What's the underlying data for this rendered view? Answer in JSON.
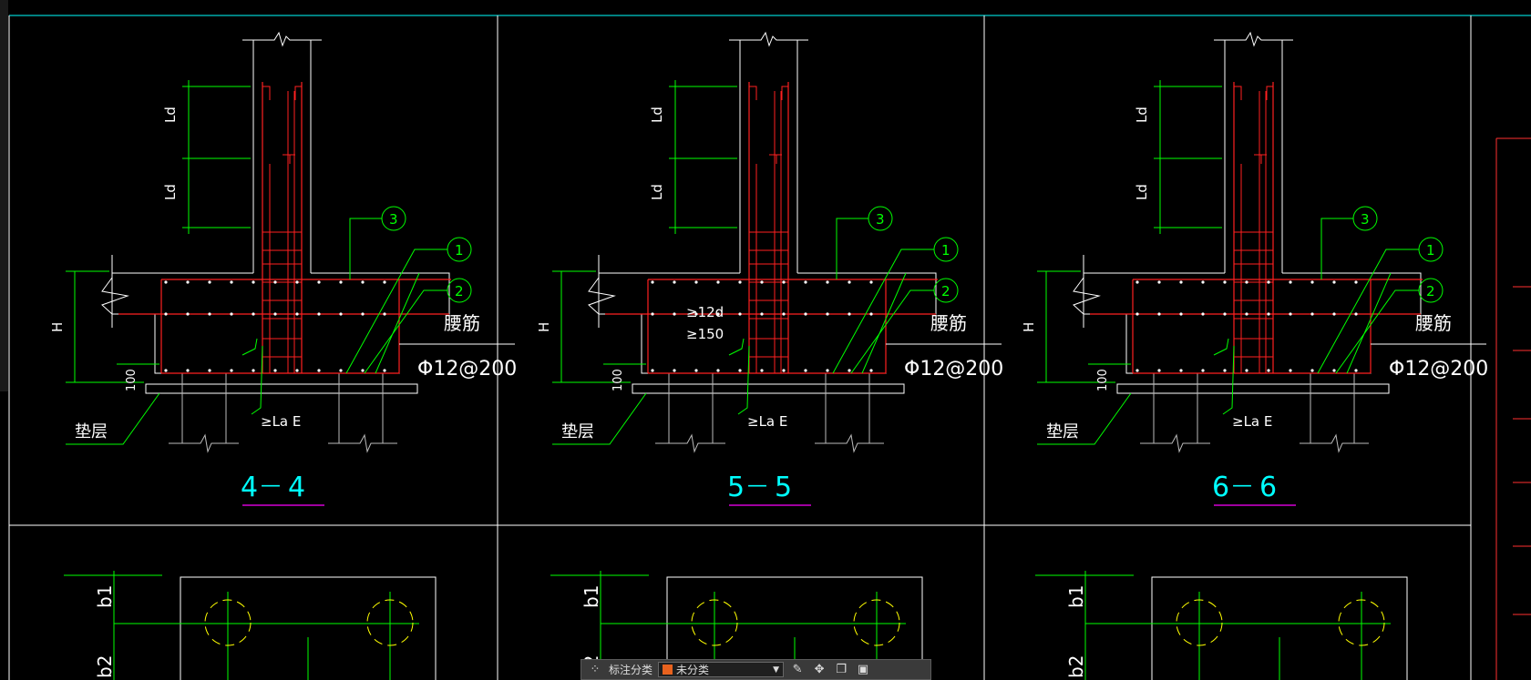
{
  "drawing": {
    "sections": [
      {
        "id": "4-4",
        "label_left": "4",
        "label_right": "4",
        "dash": "—",
        "has_spacing_note": false
      },
      {
        "id": "5-5",
        "label_left": "5",
        "label_right": "5",
        "dash": "—",
        "has_spacing_note": true
      },
      {
        "id": "6-6",
        "label_left": "6",
        "label_right": "6",
        "dash": "—",
        "has_spacing_note": false
      }
    ],
    "labels": {
      "ld": "Ld",
      "h": "H",
      "cover": "100",
      "cushion": "垫层",
      "waist_bar": "腰筋",
      "bar_spec": "Φ12@200",
      "anchor": "≥La E",
      "spacing_1": "≥12d",
      "spacing_2": "≥150",
      "callout_1": "1",
      "callout_2": "2",
      "callout_3": "3",
      "b1": "b1",
      "b2": "b2"
    },
    "colors": {
      "background": "#000000",
      "outline": "#ffffff",
      "rebar": "#ff2020",
      "dimension": "#00ff00",
      "section_label": "#00ffff",
      "underline": "#ff00ff",
      "pile": "#ffff00"
    }
  },
  "toolbar": {
    "grid_icon": "grid-icon",
    "category_label": "标注分类",
    "category_value": "未分类",
    "category_color": "#e8621e",
    "tools": [
      "edit-icon",
      "move-icon",
      "copy-icon",
      "paste-icon"
    ]
  }
}
